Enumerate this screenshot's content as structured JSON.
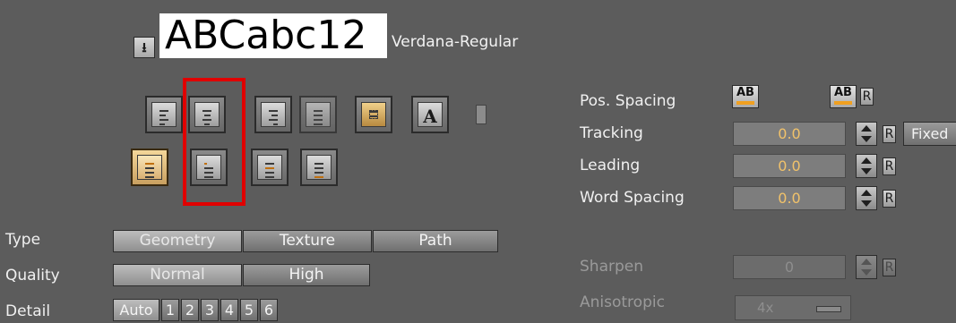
{
  "font": {
    "preview_text": "ABCabc12",
    "font_name": "Verdana-Regular"
  },
  "alignment": {
    "glyph_button": "A"
  },
  "spacing": {
    "pos_spacing_label": "Pos. Spacing",
    "ab_icon": "AB",
    "r_label": "R",
    "tracking_label": "Tracking",
    "tracking_value": "0.0",
    "fixed_label": "Fixed",
    "leading_label": "Leading",
    "leading_value": "0.0",
    "word_spacing_label": "Word Spacing",
    "word_spacing_value": "0.0"
  },
  "type_row": {
    "label": "Type",
    "options": [
      "Geometry",
      "Texture",
      "Path"
    ]
  },
  "quality_row": {
    "label": "Quality",
    "options": [
      "Normal",
      "High"
    ]
  },
  "detail_row": {
    "label": "Detail",
    "options": [
      "Auto",
      "1",
      "2",
      "3",
      "4",
      "5",
      "6"
    ]
  },
  "texture_opts": {
    "sharpen_label": "Sharpen",
    "sharpen_value": "0",
    "anisotropic_label": "Anisotropic",
    "anisotropic_value": "4x"
  },
  "colors": {
    "background": "#5c5c5c",
    "highlight": "#e00000",
    "value_orange": "#f1c26a",
    "active_button": "#f4d79a"
  }
}
